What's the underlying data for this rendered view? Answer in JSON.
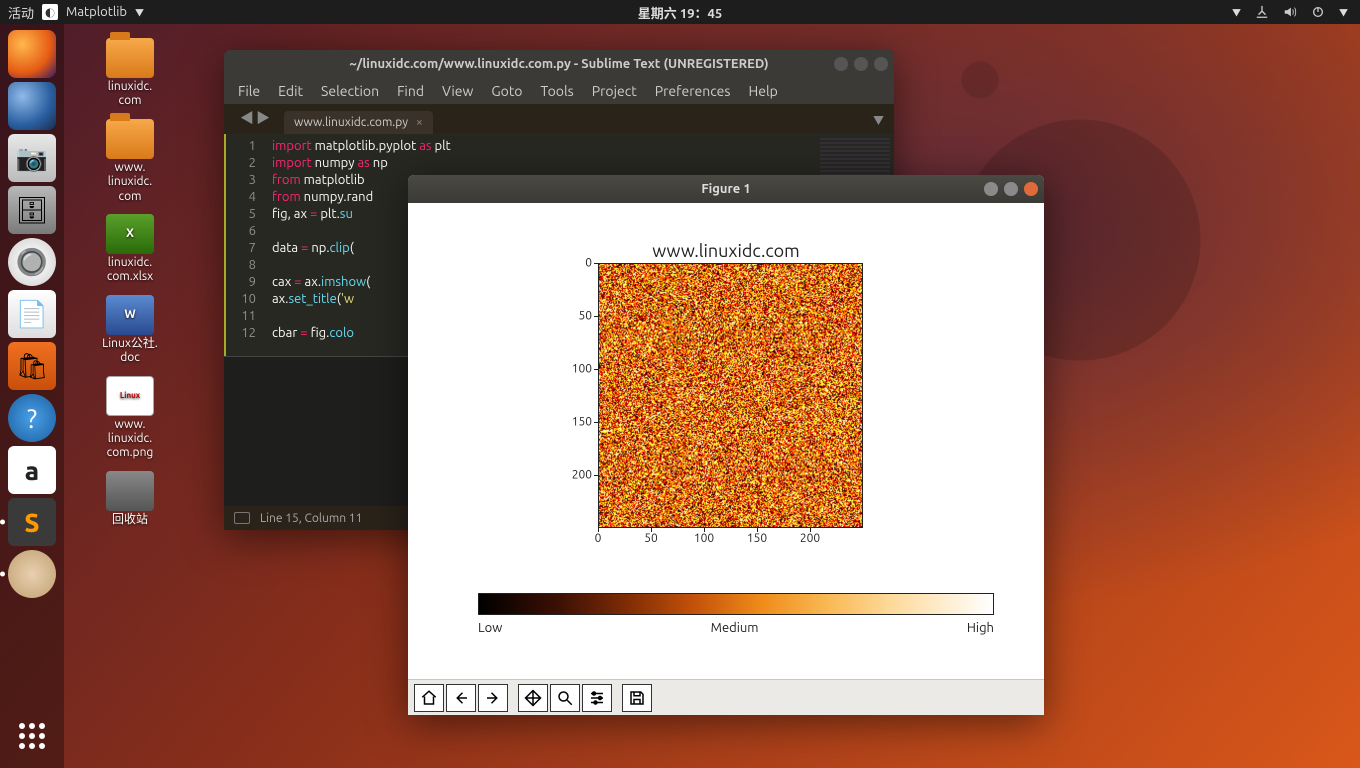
{
  "panel": {
    "activities": "活动",
    "app_name": "Matplotlib",
    "clock": "星期六 19：45"
  },
  "dock": [
    {
      "name": "firefox"
    },
    {
      "name": "thunderbird"
    },
    {
      "name": "camera"
    },
    {
      "name": "files"
    },
    {
      "name": "rhythmbox"
    },
    {
      "name": "libreoffice"
    },
    {
      "name": "software"
    },
    {
      "name": "help"
    },
    {
      "name": "amazon"
    },
    {
      "name": "sublime"
    },
    {
      "name": "matplotlib"
    }
  ],
  "desktop": [
    {
      "type": "folder",
      "label": "linuxidc.\ncom"
    },
    {
      "type": "folder",
      "label": "www.\nlinuxidc.\ncom"
    },
    {
      "type": "xls",
      "label": "linuxidc.\ncom.xlsx"
    },
    {
      "type": "doc",
      "label": "Linux公社.\ndoc"
    },
    {
      "type": "png",
      "label": "www.\nlinuxidc.\ncom.png"
    },
    {
      "type": "trash",
      "label": "回收站"
    }
  ],
  "sublime": {
    "title": "~/linuxidc.com/www.linuxidc.com.py - Sublime Text (UNREGISTERED)",
    "menu": [
      "File",
      "Edit",
      "Selection",
      "Find",
      "View",
      "Goto",
      "Tools",
      "Project",
      "Preferences",
      "Help"
    ],
    "tab": {
      "label": "www.linuxidc.com.py"
    },
    "lines": [
      "1",
      "2",
      "3",
      "4",
      "5",
      "6",
      "7",
      "8",
      "9",
      "10",
      "11",
      "12"
    ],
    "code": {
      "l1": {
        "a": "import",
        "b": " matplotlib.pyplot ",
        "c": "as",
        "d": " plt"
      },
      "l2": {
        "a": "import",
        "b": " numpy ",
        "c": "as",
        "d": " np"
      },
      "l3": {
        "a": "from",
        "b": " matplotlib "
      },
      "l4": {
        "a": "from",
        "b": " numpy.rand"
      },
      "l5": {
        "a": "fig, ax ",
        "b": "=",
        "c": " plt.",
        "d": "su"
      },
      "l7": {
        "a": "data ",
        "b": "=",
        "c": " np.",
        "d": "clip",
        "e": "("
      },
      "l9": {
        "a": "cax ",
        "b": "=",
        "c": " ax.",
        "d": "imshow",
        "e": "("
      },
      "l10": {
        "a": "ax.",
        "b": "set_title",
        "c": "(",
        "d": "'w"
      },
      "l12": {
        "a": "cbar ",
        "b": "=",
        "c": " fig.",
        "d": "colo"
      }
    },
    "status": "Line 15, Column 11"
  },
  "mpl": {
    "title": "Figure 1",
    "toolbar": [
      "home",
      "back",
      "forward",
      "pan",
      "zoom",
      "configure",
      "save"
    ]
  },
  "chart_data": {
    "type": "heatmap",
    "title": "www.linuxidc.com",
    "x_ticks": [
      "0",
      "50",
      "100",
      "150",
      "200"
    ],
    "y_ticks": [
      "0",
      "50",
      "100",
      "150",
      "200"
    ],
    "xlim": [
      0,
      250
    ],
    "ylim": [
      0,
      250
    ],
    "data_description": "250x250 random noise clipped, rendered with hot-style colormap",
    "colormap": "hot",
    "colorbar": {
      "orientation": "horizontal",
      "tick_labels": [
        "Low",
        "Medium",
        "High"
      ]
    }
  }
}
